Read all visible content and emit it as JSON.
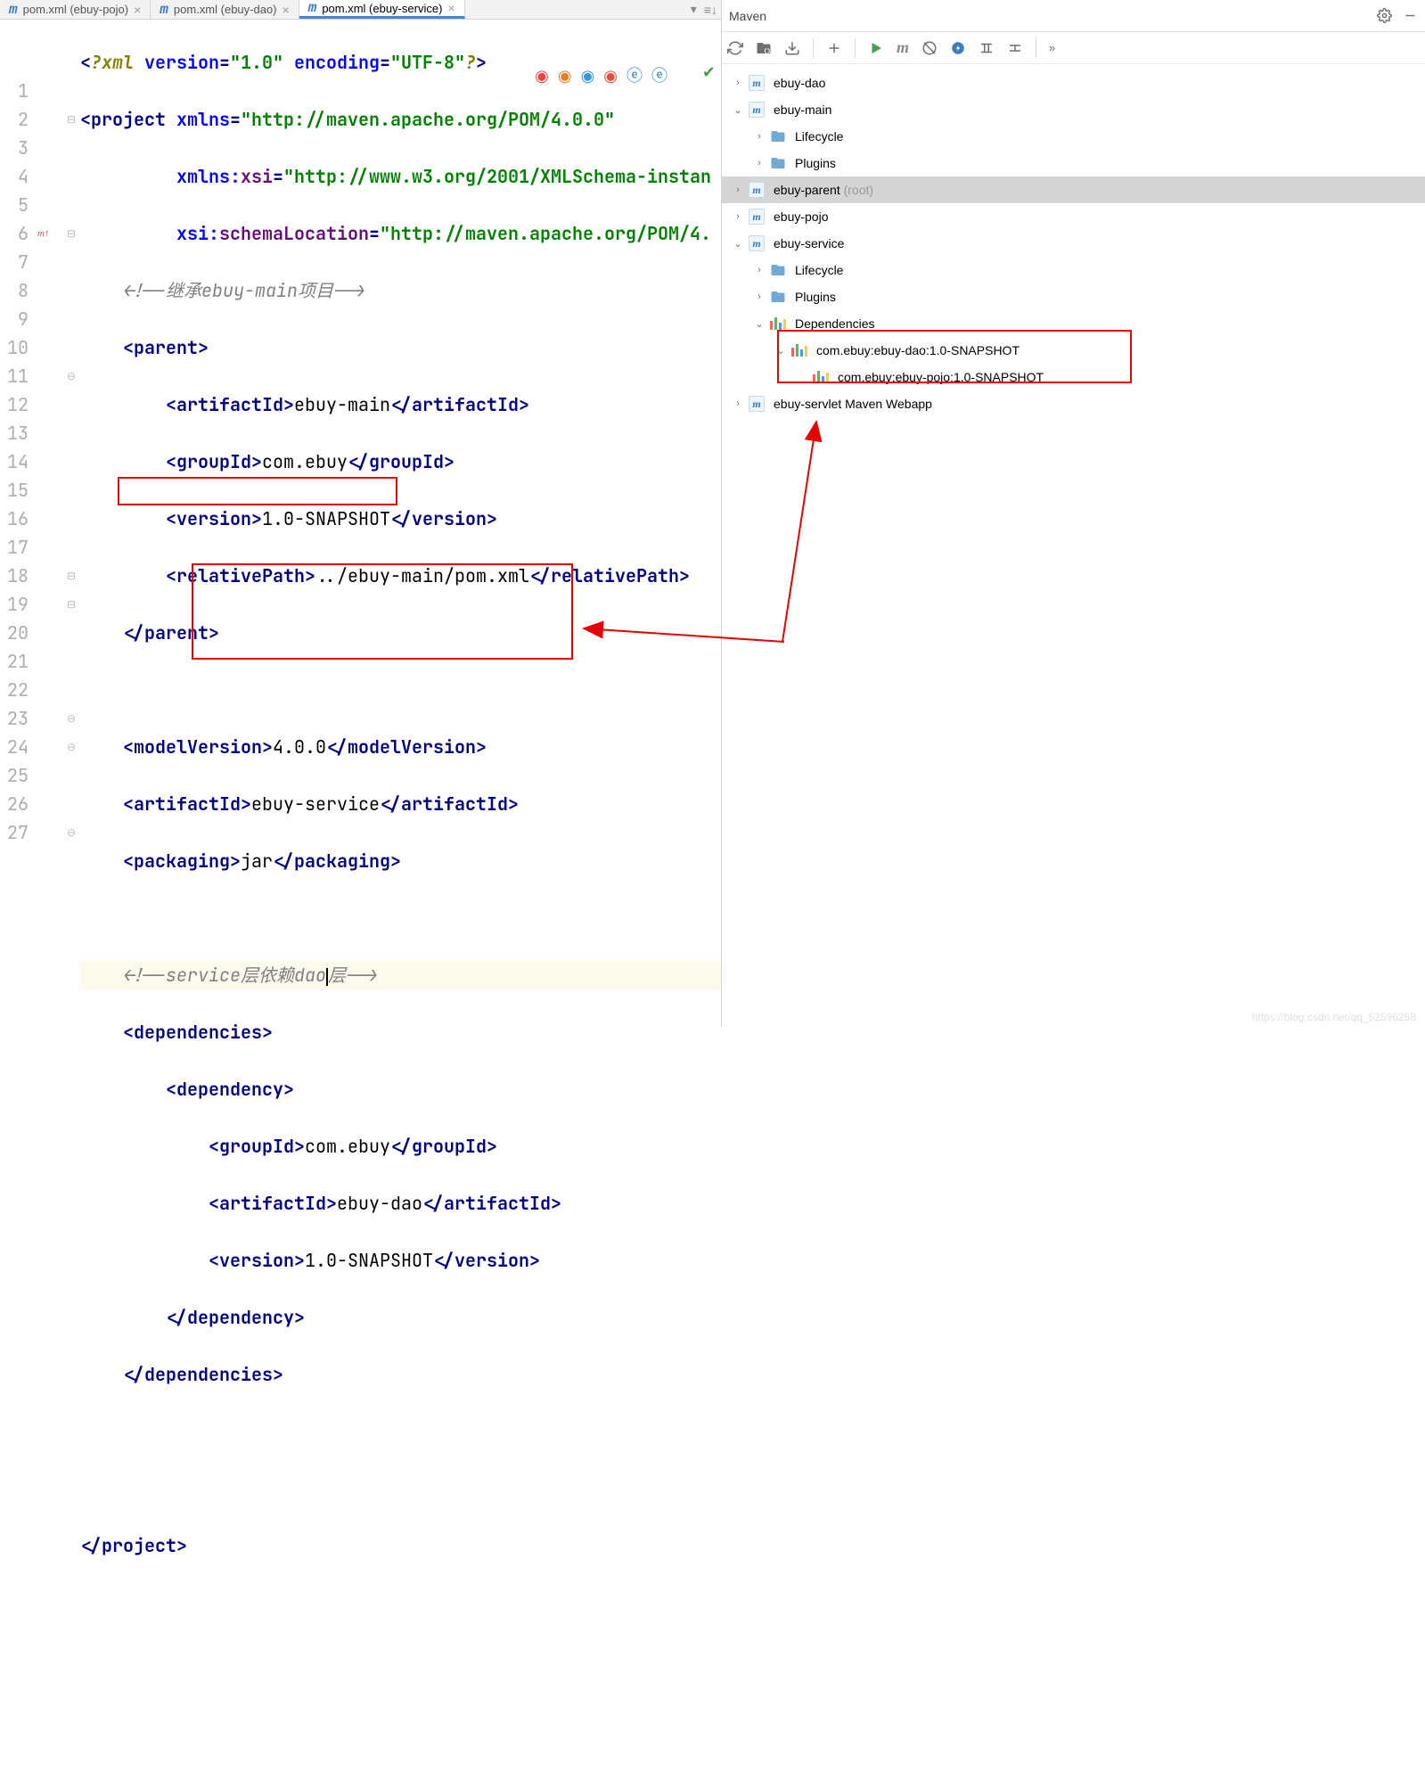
{
  "tabs": [
    {
      "label": "pom.xml (ebuy-pojo)",
      "active": false
    },
    {
      "label": "pom.xml (ebuy-dao)",
      "active": false
    },
    {
      "label": "pom.xml (ebuy-service)",
      "active": true
    }
  ],
  "lineNumbers": [
    "1",
    "2",
    "3",
    "4",
    "5",
    "6",
    "7",
    "8",
    "9",
    "10",
    "11",
    "12",
    "13",
    "14",
    "15",
    "16",
    "17",
    "18",
    "19",
    "20",
    "21",
    "22",
    "23",
    "24",
    "25",
    "26",
    "27"
  ],
  "code": {
    "xmlDecl": {
      "pi": "?xml ",
      "verAttr": "version",
      "verVal": "\"1.0\"",
      "encAttr": "encoding",
      "encVal": "\"UTF-8\"",
      "piEnd": "?"
    },
    "project": "project",
    "xmlns": "xmlns",
    "xmlnsVal": "\"http://maven.apache.org/POM/4.0.0\"",
    "xsiPrefix": "xmlns:",
    "xsiLocal": "xsi",
    "xsiVal": "\"http://www.w3.org/2001/XMLSchema-instan",
    "schemaPrefix": "xsi:",
    "schemaLocal": "schemaLocation",
    "schemaVal": "\"http://maven.apache.org/POM/4.",
    "commentParent": "!--继承ebuy-main项目--",
    "parent": "parent",
    "artifactId": "artifactId",
    "artifactVal1": "ebuy-main",
    "groupId": "groupId",
    "groupVal": "com.ebuy",
    "version": "version",
    "versionVal": "1.0-SNAPSHOT",
    "relativePath": "relativePath",
    "relVal": "../ebuy-main/pom.xml",
    "modelVersion": "modelVersion",
    "modelVal": "4.0.0",
    "artifactVal2": "ebuy-service",
    "packaging": "packaging",
    "packVal": "jar",
    "commentService": "!--service层依赖dao层--",
    "commentServiceA": "!--service层依赖dao",
    "commentServiceB": "层--",
    "dependencies": "dependencies",
    "dependency": "dependency",
    "depGroupVal": "com.ebuy",
    "depArtifactVal": "ebuy-dao",
    "depVersionVal": "1.0-SNAPSHOT"
  },
  "mavenPanel": {
    "title": "Maven",
    "tree": {
      "ebuyDao": "ebuy-dao",
      "ebuyMain": "ebuy-main",
      "lifecycle": "Lifecycle",
      "plugins": "Plugins",
      "ebuyParent": "ebuy-parent",
      "root": "(root)",
      "ebuyPojo": "ebuy-pojo",
      "ebuyService": "ebuy-service",
      "dependencies": "Dependencies",
      "dep1": "com.ebuy:ebuy-dao:1.0-SNAPSHOT",
      "dep2": "com.ebuy:ebuy-pojo:1.0-SNAPSHOT",
      "ebuyServlet": "ebuy-servlet Maven Webapp"
    }
  },
  "watermark": "https://blog.csdn.net/qq_52596258"
}
